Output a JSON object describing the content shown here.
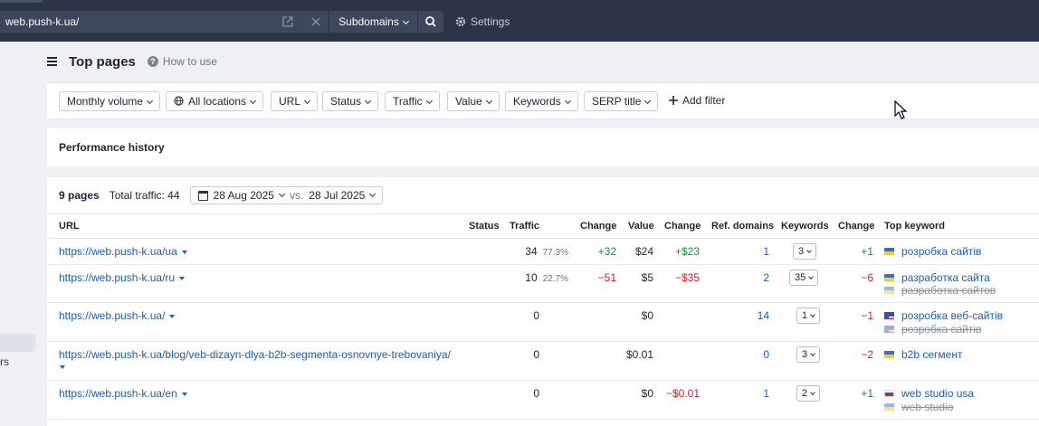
{
  "topbar": {
    "url_value": "web.push-k.ua/",
    "mode_label": "Subdomains",
    "settings_label": "Settings"
  },
  "sidebar": {
    "partial_label": "rs"
  },
  "header": {
    "title": "Top pages",
    "how_to_use": "How to use"
  },
  "filters": [
    {
      "label": "Monthly volume"
    },
    {
      "label": "All locations"
    },
    {
      "label": "URL"
    },
    {
      "label": "Status"
    },
    {
      "label": "Traffic"
    },
    {
      "label": "Value"
    },
    {
      "label": "Keywords"
    },
    {
      "label": "SERP title"
    }
  ],
  "add_filter_label": "Add filter",
  "performance": {
    "title": "Performance history"
  },
  "summary": {
    "pages": "9 pages",
    "total_traffic": "Total traffic: 44",
    "date_current": "28 Aug 2025",
    "vs": "vs.",
    "date_compare": "28 Jul 2025"
  },
  "columns": [
    "URL",
    "Status",
    "Traffic",
    "Change",
    "Value",
    "Change",
    "Ref. domains",
    "Keywords",
    "Change",
    "Top keyword"
  ],
  "rows": [
    {
      "url": "https://web.push-k.ua/ua",
      "traffic": "34",
      "traffic_pct": "77.3%",
      "traffic_change": "+32",
      "value": "$24",
      "value_change": "+$23",
      "ref_domains": "1",
      "keywords": "3",
      "kw_change": "+1",
      "top_keyword": "розробка сайтів",
      "top_keyword_prev": ""
    },
    {
      "url": "https://web.push-k.ua/ru",
      "traffic": "10",
      "traffic_pct": "22.7%",
      "traffic_change": "−51",
      "value": "$5",
      "value_change": "−$35",
      "ref_domains": "2",
      "keywords": "35",
      "kw_change": "−6",
      "top_keyword": "разработка сайта",
      "top_keyword_prev": "разработка сайтов"
    },
    {
      "url": "https://web.push-k.ua/",
      "traffic": "0",
      "traffic_pct": "",
      "traffic_change": "",
      "value": "$0",
      "value_change": "",
      "ref_domains": "14",
      "keywords": "1",
      "kw_change": "−1",
      "top_keyword": "розробка веб-сайтів",
      "top_keyword_prev": "розробка сайтів"
    },
    {
      "url": "https://web.push-k.ua/blog/veb-dizayn-dlya-b2b-segmenta-osnovnye-trebovaniya/",
      "traffic": "0",
      "traffic_pct": "",
      "traffic_change": "",
      "value": "$0.01",
      "value_change": "",
      "ref_domains": "0",
      "keywords": "3",
      "kw_change": "−2",
      "top_keyword": "b2b сегмент",
      "top_keyword_prev": ""
    },
    {
      "url": "https://web.push-k.ua/en",
      "traffic": "0",
      "traffic_pct": "",
      "traffic_change": "",
      "value": "$0",
      "value_change": "−$0.01",
      "ref_domains": "1",
      "keywords": "2",
      "kw_change": "+1",
      "top_keyword": "web studio usa",
      "top_keyword_prev": "web studio"
    }
  ]
}
